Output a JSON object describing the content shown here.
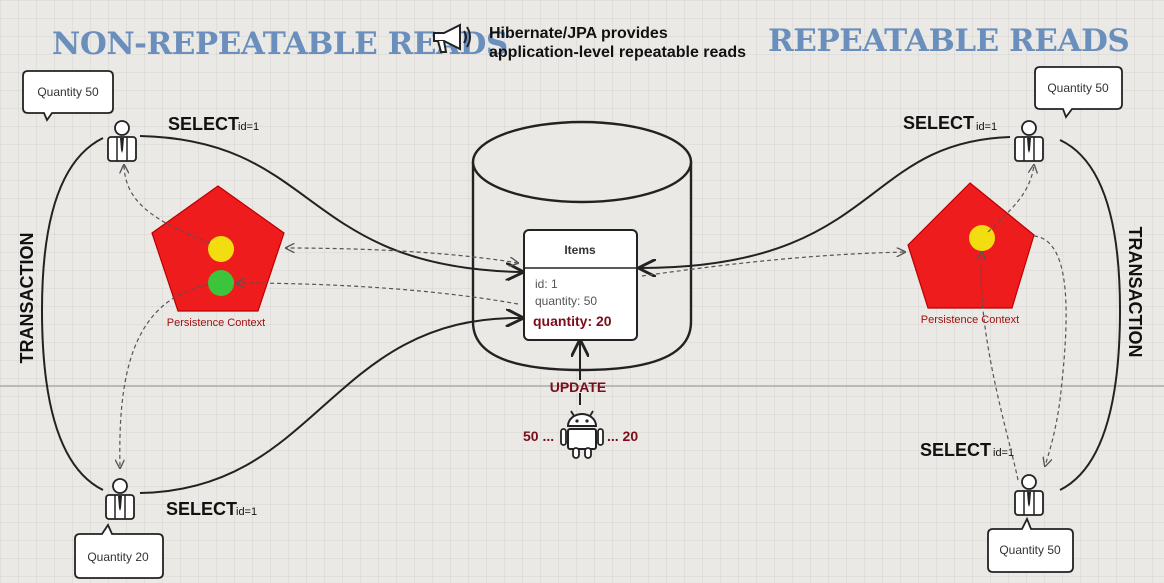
{
  "titles": {
    "left": "NON-REPEATABLE READS",
    "right": "REPEATABLE READS"
  },
  "note": {
    "line1": "Hibernate/JPA provides",
    "line2": "application-level repeatable reads",
    "icon": "megaphone-icon"
  },
  "left": {
    "top_bubble": "Quantity 50",
    "bottom_bubble": "Quantity 20",
    "select_top": "SELECT",
    "select_top_id": "id=1",
    "select_bottom": "SELECT",
    "select_bottom_id": "id=1",
    "transaction": "TRANSACTION",
    "persistence_label": "Persistence Context"
  },
  "right": {
    "top_bubble": "Quantity 50",
    "bottom_bubble": "Quantity 50",
    "select_top": "SELECT",
    "select_top_id": "id=1",
    "select_bottom": "SELECT",
    "select_bottom_id": "id=1",
    "transaction": "TRANSACTION",
    "persistence_label": "Persistence Context"
  },
  "database": {
    "table_title": "Items",
    "row_id": "id: 1",
    "row_qty_old": "quantity: 50",
    "row_qty_new": "quantity: 20"
  },
  "update": {
    "label": "UPDATE",
    "from": "50 ...",
    "to": "... 20"
  },
  "colors": {
    "pentagon": "#ee1c1c",
    "yellow": "#f2dd10",
    "green": "#3cc43c",
    "title_blue": "#6a8fbd",
    "dark_red": "#7a0d1a"
  }
}
